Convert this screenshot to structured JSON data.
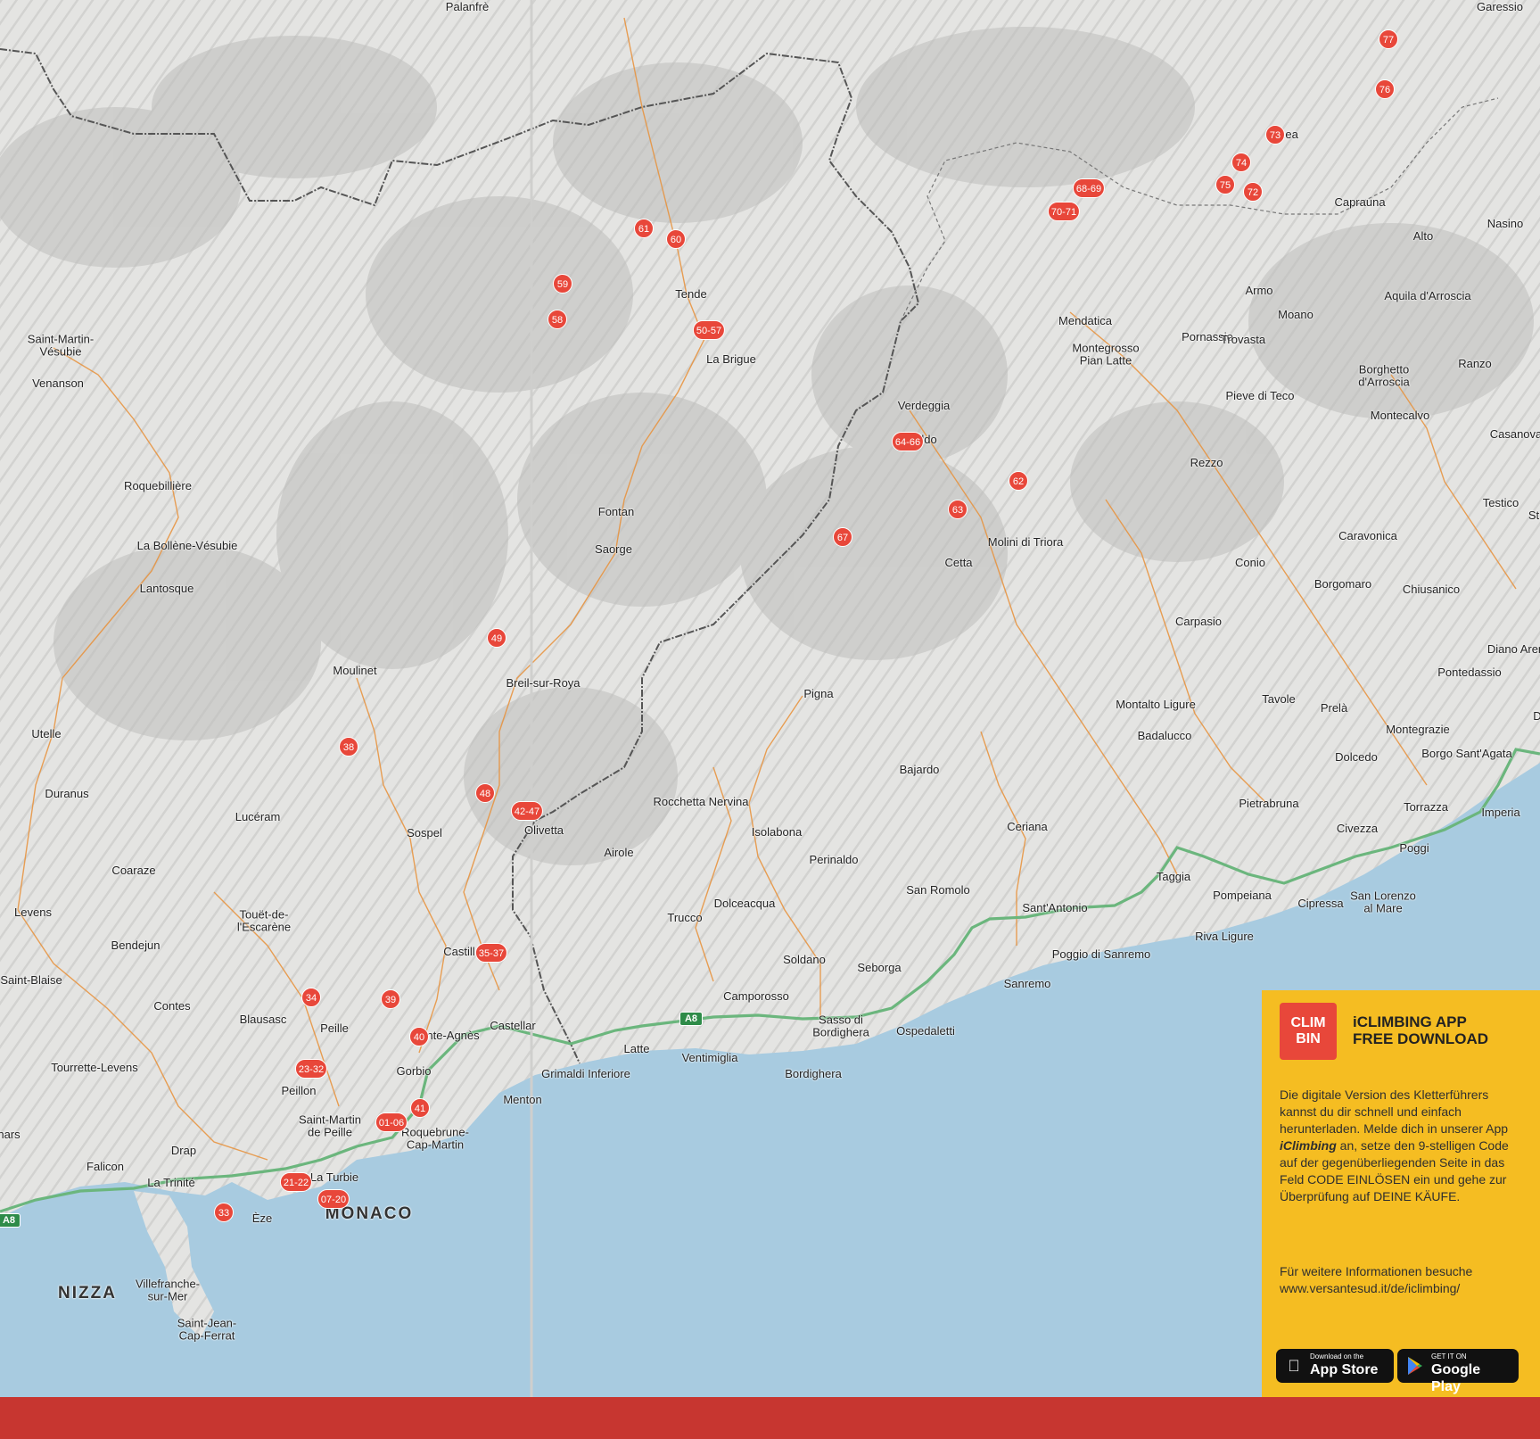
{
  "map": {
    "colors": {
      "land": "#e6e6e4",
      "relief": "#bdbdbb",
      "sea": "#a8cbe0",
      "road": "#e8913a",
      "motorway": "#6bb67d",
      "border": "#555555",
      "marker": "#e8473a"
    },
    "places": [
      {
        "id": "palanfre",
        "name": "Palanfrè"
      },
      {
        "id": "garessio",
        "name": "Garessio"
      },
      {
        "id": "saint-martin-vesubie",
        "name": "Saint-Martin-\nVésubie"
      },
      {
        "id": "venanson",
        "name": "Venanson"
      },
      {
        "id": "roquebilliere",
        "name": "Roquebillière"
      },
      {
        "id": "la-bollene-vesubie",
        "name": "La Bollène-Vésubie"
      },
      {
        "id": "lantosque",
        "name": "Lantosque"
      },
      {
        "id": "utelle",
        "name": "Utelle"
      },
      {
        "id": "duranus",
        "name": "Duranus"
      },
      {
        "id": "moulinet",
        "name": "Moulinet"
      },
      {
        "id": "luceram",
        "name": "Lucéram"
      },
      {
        "id": "coaraze",
        "name": "Coaraze"
      },
      {
        "id": "levens",
        "name": "Levens"
      },
      {
        "id": "bendejun",
        "name": "Bendejun"
      },
      {
        "id": "saint-blaise",
        "name": "Saint-Blaise"
      },
      {
        "id": "touet",
        "name": "Touët-de-\nl'Escarène"
      },
      {
        "id": "contes",
        "name": "Contes"
      },
      {
        "id": "blausasc",
        "name": "Blausasc"
      },
      {
        "id": "peille",
        "name": "Peille"
      },
      {
        "id": "tourrette-levens",
        "name": "Tourrette-Levens"
      },
      {
        "id": "peillon",
        "name": "Peillon"
      },
      {
        "id": "nars",
        "name": "nars"
      },
      {
        "id": "saint-martin-de-peille",
        "name": "Saint-Martin\nde Peille"
      },
      {
        "id": "falicon",
        "name": "Falicon"
      },
      {
        "id": "drap",
        "name": "Drap"
      },
      {
        "id": "la-trinite",
        "name": "La Trinité"
      },
      {
        "id": "la-turbie",
        "name": "La Turbie"
      },
      {
        "id": "eze",
        "name": "Èze"
      },
      {
        "id": "nizza",
        "name": "NIZZA",
        "big": true
      },
      {
        "id": "monaco",
        "name": "MONACO",
        "big": true
      },
      {
        "id": "villefranche",
        "name": "Villefranche-\nsur-Mer"
      },
      {
        "id": "saint-jean",
        "name": "Saint-Jean-\nCap-Ferrat"
      },
      {
        "id": "tende",
        "name": "Tende"
      },
      {
        "id": "la-brigue",
        "name": "La Brigue"
      },
      {
        "id": "fontan",
        "name": "Fontan"
      },
      {
        "id": "saorge",
        "name": "Saorge"
      },
      {
        "id": "breil",
        "name": "Breil-sur-Roya"
      },
      {
        "id": "sospel",
        "name": "Sospel"
      },
      {
        "id": "olivetta",
        "name": "Olivetta"
      },
      {
        "id": "castillon",
        "name": "Castill"
      },
      {
        "id": "sainte-agnes",
        "name": "nte-Agnès"
      },
      {
        "id": "castellar",
        "name": "Castellar"
      },
      {
        "id": "gorbio",
        "name": "Gorbio"
      },
      {
        "id": "menton",
        "name": "Menton"
      },
      {
        "id": "roquebrune",
        "name": "Roquebrune-\nCap-Martin"
      },
      {
        "id": "grimaldi",
        "name": "Grimaldi Inferiore"
      },
      {
        "id": "latte",
        "name": "Latte"
      },
      {
        "id": "ventimiglia",
        "name": "Ventimiglia"
      },
      {
        "id": "bordighera",
        "name": "Bordighera"
      },
      {
        "id": "sasso",
        "name": "Sasso di\nBordighera"
      },
      {
        "id": "camporosso",
        "name": "Camporosso"
      },
      {
        "id": "ospedaletti",
        "name": "Ospedaletti"
      },
      {
        "id": "rocchetta",
        "name": "Rocchetta Nervina"
      },
      {
        "id": "airole",
        "name": "Airole"
      },
      {
        "id": "isolabona",
        "name": "Isolabona"
      },
      {
        "id": "perinaldo",
        "name": "Perinaldo"
      },
      {
        "id": "dolceacqua",
        "name": "Dolceacqua"
      },
      {
        "id": "trucco",
        "name": "Trucco"
      },
      {
        "id": "soldano",
        "name": "Soldano"
      },
      {
        "id": "seborga",
        "name": "Seborga"
      },
      {
        "id": "san-romolo",
        "name": "San Romolo"
      },
      {
        "id": "sanremo",
        "name": "Sanremo"
      },
      {
        "id": "poggio-sanremo",
        "name": "Poggio di Sanremo"
      },
      {
        "id": "santantonio",
        "name": "Sant'Antonio"
      },
      {
        "id": "ceriana",
        "name": "Ceriana"
      },
      {
        "id": "bajardo",
        "name": "Bajardo"
      },
      {
        "id": "pigna",
        "name": "Pigna"
      },
      {
        "id": "verdeggia",
        "name": "Verdeggia"
      },
      {
        "id": "realdo",
        "name": "ldo"
      },
      {
        "id": "cetta",
        "name": "Cetta"
      },
      {
        "id": "molini",
        "name": "Molini di Triora"
      },
      {
        "id": "mendatica",
        "name": "Mendatica"
      },
      {
        "id": "montegrosso",
        "name": "Montegrosso\nPian Latte"
      },
      {
        "id": "pornassio",
        "name": "Pornassio"
      },
      {
        "id": "armo",
        "name": "Armo"
      },
      {
        "id": "moano",
        "name": "Moano"
      },
      {
        "id": "trovasta",
        "name": "Trovasta"
      },
      {
        "id": "pieve-di-teco",
        "name": "Pieve di Teco"
      },
      {
        "id": "aquila",
        "name": "Aquila d'Arroscia"
      },
      {
        "id": "borghetto",
        "name": "Borghetto\nd'Arroscia"
      },
      {
        "id": "ranzo",
        "name": "Ranzo"
      },
      {
        "id": "montecalvo",
        "name": "Montecalvo"
      },
      {
        "id": "casanova",
        "name": "Casanova"
      },
      {
        "id": "testico",
        "name": "Testico"
      },
      {
        "id": "st",
        "name": "St"
      },
      {
        "id": "rezzo",
        "name": "Rezzo"
      },
      {
        "id": "caravonica",
        "name": "Caravonica"
      },
      {
        "id": "conio",
        "name": "Conio"
      },
      {
        "id": "borgomaro",
        "name": "Borgomaro"
      },
      {
        "id": "chiusanico",
        "name": "Chiusanico"
      },
      {
        "id": "carpasio",
        "name": "Carpasio"
      },
      {
        "id": "diano-arentino",
        "name": "Diano Aren"
      },
      {
        "id": "pontedassio",
        "name": "Pontedassio"
      },
      {
        "id": "montalto",
        "name": "Montalto Ligure"
      },
      {
        "id": "badalucco",
        "name": "Badalucco"
      },
      {
        "id": "tavole",
        "name": "Tavole"
      },
      {
        "id": "prela",
        "name": "Prelà"
      },
      {
        "id": "montegrazie",
        "name": "Montegrazie"
      },
      {
        "id": "dolcedo",
        "name": "Dolcedo"
      },
      {
        "id": "borgo-sant-agata",
        "name": "Borgo Sant'Agata"
      },
      {
        "id": "pietrabruna",
        "name": "Pietrabruna"
      },
      {
        "id": "torrazza",
        "name": "Torrazza"
      },
      {
        "id": "civezza",
        "name": "Civezza"
      },
      {
        "id": "imperia",
        "name": "Imperia"
      },
      {
        "id": "poggi",
        "name": "Poggi"
      },
      {
        "id": "taggia",
        "name": "Taggia"
      },
      {
        "id": "pompeiana",
        "name": "Pompeiana"
      },
      {
        "id": "riva-ligure",
        "name": "Riva Ligure"
      },
      {
        "id": "cipressa",
        "name": "Cipressa"
      },
      {
        "id": "san-lorenzo",
        "name": "San Lorenzo\nal Mare"
      },
      {
        "id": "capraun",
        "name": "Caprauna"
      },
      {
        "id": "alto",
        "name": "Alto"
      },
      {
        "id": "nasino",
        "name": "Nasino"
      },
      {
        "id": "nea",
        "name": "nea"
      },
      {
        "id": "d",
        "name": "D"
      }
    ],
    "markers": [
      "77",
      "76",
      "73",
      "74",
      "75",
      "72",
      "68-69",
      "70-71",
      "61",
      "60",
      "59",
      "58",
      "50-57",
      "64-66",
      "62",
      "63",
      "67",
      "49",
      "38",
      "48",
      "42-47",
      "35-37",
      "34",
      "39",
      "40",
      "23-32",
      "41",
      "01-06",
      "21-22",
      "07-20",
      "33"
    ],
    "roads": [
      "A8",
      "A8"
    ]
  },
  "promo": {
    "logo_text": "CLIM\nBIN",
    "app_title": "iCLIMBING APP\nFREE DOWNLOAD",
    "description_pre": "Die digitale Version des Kletterführers kannst du dir schnell und einfach herunterladen. Melde dich in unserer App ",
    "description_app": "iClimbing",
    "description_post": " an, setze den 9-stelligen Code auf der gegenüberliegenden Seite in das Feld CODE EINLÖSEN ein und gehe zur Überprüfung auf DEINE KÄUFE.",
    "more_info": "Für weitere Informationen besuche\nwww.versantesud.it/de/iclimbing/",
    "appstore_small": "Download on the",
    "appstore_big": "App Store",
    "googleplay_small": "GET IT ON",
    "googleplay_big": "Google Play"
  }
}
